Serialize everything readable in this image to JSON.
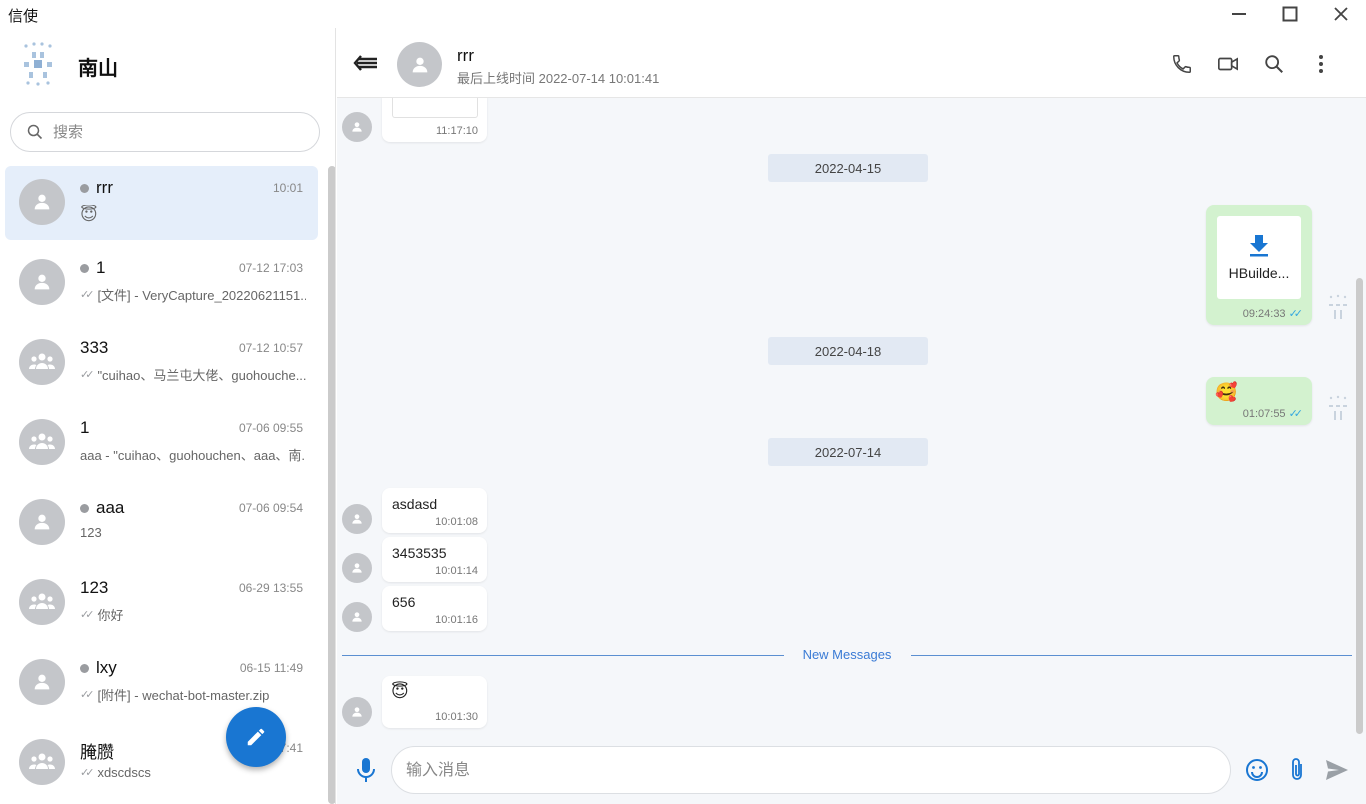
{
  "app": {
    "title": "信使"
  },
  "sidebar": {
    "user_name": "南山",
    "search_placeholder": "搜索",
    "chats": [
      {
        "name": "rrr",
        "online_dot": true,
        "time": "10:01",
        "preview": "😇",
        "read": false,
        "type": "person",
        "active": true
      },
      {
        "name": "1",
        "online_dot": true,
        "time": "07-12 17:03",
        "preview": "[文件] - VeryCapture_20220621151...",
        "read": true,
        "type": "person",
        "active": false
      },
      {
        "name": "333",
        "online_dot": false,
        "time": "07-12 10:57",
        "preview": "\"cuihao、马兰屯大佬、guohouche...",
        "read": true,
        "type": "group",
        "active": false
      },
      {
        "name": "1",
        "online_dot": false,
        "time": "07-06 09:55",
        "preview": "aaa - \"cuihao、guohouchen、aaa、南...",
        "read": false,
        "type": "group",
        "active": false
      },
      {
        "name": "aaa",
        "online_dot": true,
        "time": "07-06 09:54",
        "preview": "123",
        "read": false,
        "type": "person",
        "active": false
      },
      {
        "name": "123",
        "online_dot": false,
        "time": "06-29 13:55",
        "preview": "你好",
        "read": true,
        "type": "group",
        "active": false
      },
      {
        "name": "lxy",
        "online_dot": true,
        "time": "06-15 11:49",
        "preview": "[附件] - wechat-bot-master.zip",
        "read": true,
        "type": "person",
        "active": false
      },
      {
        "name": "腌臜",
        "online_dot": false,
        "time": "7:41",
        "preview": "xdscdscs",
        "read": true,
        "type": "group",
        "active": false
      }
    ]
  },
  "header": {
    "name": "rrr",
    "status": "最后上线时间 2022-07-14 10:01:41"
  },
  "messages": {
    "top_partial_time": "11:17:10",
    "dates": [
      "2022-04-15",
      "2022-04-18",
      "2022-07-14"
    ],
    "file_message": {
      "file_name": "HBuilde...",
      "time": "09:24:33"
    },
    "emoji_message": {
      "emoji": "🥰",
      "time": "01:07:55"
    },
    "incoming": [
      {
        "text": "asdasd",
        "time": "10:01:08"
      },
      {
        "text": "3453535",
        "time": "10:01:14"
      },
      {
        "text": "656",
        "time": "10:01:16"
      }
    ],
    "new_messages_label": "New Messages",
    "last_message": {
      "emoji": "😇",
      "time": "10:01:30"
    }
  },
  "composer": {
    "placeholder": "输入消息"
  },
  "icons": {
    "accent": "#1976d2",
    "bubble_out": "#d3f2cf",
    "active_chat": "#e5eefa"
  }
}
